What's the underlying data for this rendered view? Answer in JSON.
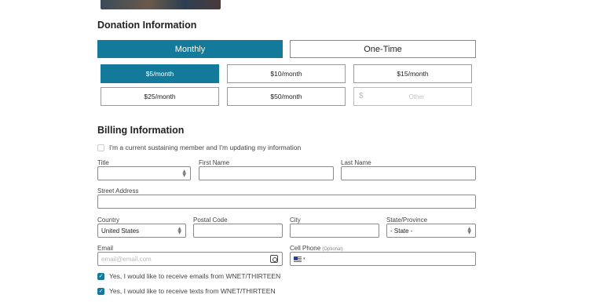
{
  "donation": {
    "title": "Donation Information",
    "frequency": [
      {
        "label": "Monthly",
        "active": true
      },
      {
        "label": "One-Time",
        "active": false
      }
    ],
    "amounts": [
      {
        "label": "$5/month",
        "active": true
      },
      {
        "label": "$10/month",
        "active": false
      },
      {
        "label": "$15/month",
        "active": false
      },
      {
        "label": "$25/month",
        "active": false
      },
      {
        "label": "$50/month",
        "active": false
      }
    ],
    "other": {
      "currency": "$",
      "placeholder": "Other"
    }
  },
  "billing": {
    "title": "Billing Information",
    "sustaining_checkbox": {
      "label": "I'm a current sustaining member and I'm updating my information",
      "checked": false
    },
    "title_label": "Title",
    "first_name_label": "First Name",
    "last_name_label": "Last Name",
    "street_label": "Street Address",
    "country_label": "Country",
    "country_value": "United States",
    "postal_label": "Postal Code",
    "city_label": "City",
    "state_label": "State/Province",
    "state_value": "- State -",
    "email_label": "Email",
    "email_placeholder": "email@email.com",
    "phone_label": "Cell Phone",
    "phone_optional": "(Optional)",
    "phone_country_caret": "▾",
    "email_optin": {
      "label": "Yes, I would like to receive emails from WNET/THIRTEEN",
      "checked": true
    },
    "text_optin": {
      "label": "Yes, I would like to receive texts from WNET/THIRTEEN",
      "checked": true
    }
  },
  "colors": {
    "accent": "#137a9b"
  }
}
